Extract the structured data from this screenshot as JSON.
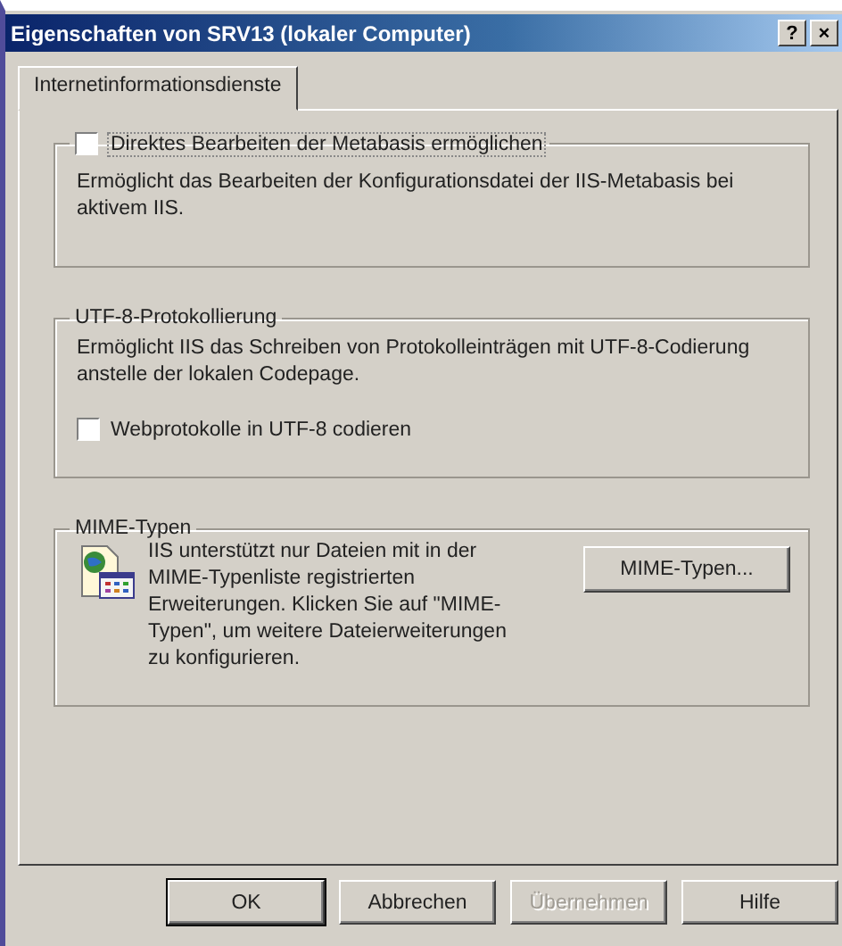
{
  "window": {
    "title": "Eigenschaften von SRV13 (lokaler Computer)",
    "help_button": "?",
    "close_button": "×"
  },
  "tabs": [
    {
      "label": "Internetinformationsdienste",
      "selected": true
    }
  ],
  "groups": [
    {
      "kind": "checkbox-title",
      "title": "Direktes Bearbeiten der Metabasis ermöglichen",
      "checked": false,
      "description": "Ermöglicht das Bearbeiten der Konfigurationsdatei der IIS-Metabasis bei aktivem IIS."
    },
    {
      "kind": "text-title",
      "title": "UTF-8-Protokollierung",
      "description": "Ermöglicht IIS das Schreiben von Protokolleinträgen mit UTF-8-Codierung anstelle der lokalen Codepage.",
      "checkbox": {
        "label": "Webprotokolle in UTF-8 codieren",
        "checked": false
      }
    },
    {
      "kind": "icon-button",
      "title": "MIME-Typen",
      "description": "IIS unterstützt nur Dateien mit in der MIME-Typenliste registrierten Erweiterungen. Klicken Sie auf \"MIME-Typen\", um weitere Dateierweiterungen zu konfigurieren.",
      "button": "MIME-Typen..."
    }
  ],
  "buttons": [
    {
      "label": "OK",
      "disabled": false,
      "default": true
    },
    {
      "label": "Abbrechen",
      "disabled": false,
      "default": false
    },
    {
      "label": "Übernehmen",
      "disabled": true,
      "default": false
    },
    {
      "label": "Hilfe",
      "disabled": false,
      "default": false
    }
  ]
}
